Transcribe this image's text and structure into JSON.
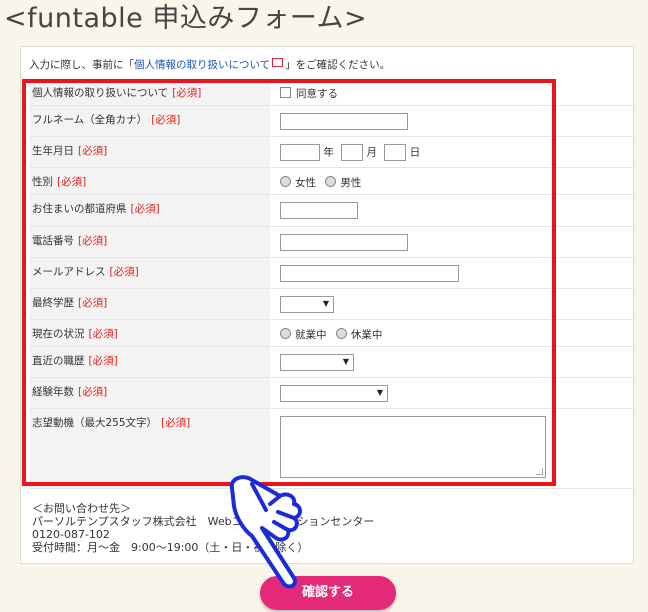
{
  "page_title": "<funtable 申込みフォーム>",
  "notice": {
    "before": "入力に際し、事前に「",
    "link": "個人情報の取り扱いについて",
    "after": "」をご確認ください。"
  },
  "required": "[必須]",
  "rows": {
    "privacy": {
      "label": "個人情報の取り扱いについて",
      "checkbox": "同意する"
    },
    "name": {
      "label": "フルネーム（全角カナ）"
    },
    "birth": {
      "label": "生年月日",
      "year": "年",
      "month": "月",
      "day": "日"
    },
    "gender": {
      "label": "性別",
      "female": "女性",
      "male": "男性"
    },
    "pref": {
      "label": "お住まいの都道府県"
    },
    "phone": {
      "label": "電話番号"
    },
    "email": {
      "label": "メールアドレス"
    },
    "edu": {
      "label": "最終学歴"
    },
    "status": {
      "label": "現在の状況",
      "working": "就業中",
      "leave": "休業中"
    },
    "job": {
      "label": "直近の職歴"
    },
    "years": {
      "label": "経験年数"
    },
    "motive": {
      "label": "志望動機（最大255文字）"
    }
  },
  "contact": {
    "line1": "＜お問い合わせ先＞",
    "line2": "パーソルテンプスタッフ株式会社　Webコミュニケーションセンター",
    "line3": "0120-087-102",
    "line4": "受付時間：月～金　9:00～19:00（土・日・祝日除く）"
  },
  "confirm_button": "確認する",
  "colors": {
    "accent": "#e22a78",
    "highlight": "#e8161c",
    "required": "#e0201a",
    "link": "#1a55b8"
  }
}
